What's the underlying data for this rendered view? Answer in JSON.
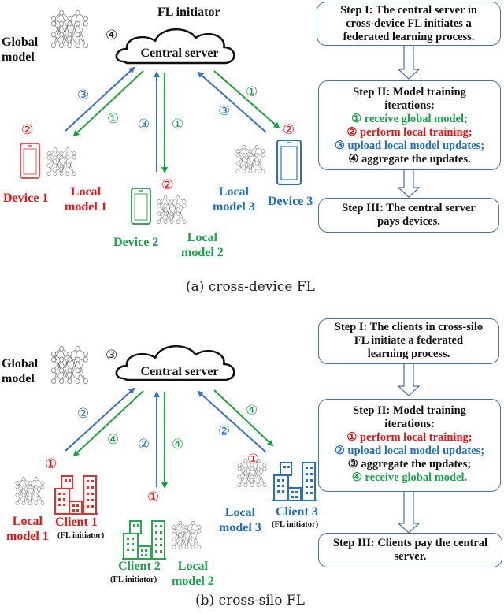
{
  "colors": {
    "red": "#ee1111",
    "green": "#1aa34a",
    "blue": "#1e6fc0",
    "arrow_blue": "#3b6fc8",
    "arrow_green": "#19a33a",
    "box_border": "#4a6fa5"
  },
  "panel_a": {
    "caption": "(a)  cross-device FL",
    "fl_initiator": "FL initiator",
    "server_label": "Central server",
    "global_model": [
      "Global",
      "model"
    ],
    "aggregate_marker": "④",
    "devices": [
      {
        "name": "Device 1",
        "local_model": [
          "Local",
          "model 1"
        ],
        "color": "red",
        "train_marker": "②",
        "up_marker": "③",
        "down_marker": "①"
      },
      {
        "name": "Device 2",
        "local_model": [
          "Local",
          "model 2"
        ],
        "color": "green",
        "train_marker": "②",
        "up_marker": "③",
        "down_marker": "①"
      },
      {
        "name": "Device 3",
        "local_model": [
          "Local",
          "model 3"
        ],
        "color": "blue",
        "train_marker": "②",
        "up_marker": "③",
        "down_marker": "①"
      }
    ],
    "steps": {
      "step1": [
        "Step I: The central server in",
        "cross-device FL initiates a",
        "federated learning process."
      ],
      "step2_title": [
        "Step II: Model training",
        "iterations:"
      ],
      "step2_items": [
        {
          "text": "① receive global model;",
          "color": "green"
        },
        {
          "text": "② perform local training;",
          "color": "red"
        },
        {
          "text": "③ upload local model updates;",
          "color": "blue"
        },
        {
          "text": "④ aggregate the updates.",
          "color": "black"
        }
      ],
      "step3": [
        "Step III: The central server",
        "pays devices."
      ]
    }
  },
  "panel_b": {
    "caption": "(b)  cross-silo FL",
    "server_label": "Central server",
    "global_model": [
      "Global",
      "model"
    ],
    "aggregate_marker": "③",
    "clients": [
      {
        "name": "Client 1",
        "sub": "(FL initiator)",
        "local_model": [
          "Local",
          "model 1"
        ],
        "color": "red",
        "train_marker": "①",
        "up_marker": "②",
        "down_marker": "④"
      },
      {
        "name": "Client 2",
        "sub": "(FL initiator)",
        "local_model": [
          "Local",
          "model 2"
        ],
        "color": "green",
        "train_marker": "①",
        "up_marker": "②",
        "down_marker": "④"
      },
      {
        "name": "Client 3",
        "sub": "(FL initiator)",
        "local_model": [
          "Local",
          "model 3"
        ],
        "color": "blue",
        "train_marker": "①",
        "up_marker": "②",
        "down_marker": "④"
      }
    ],
    "steps": {
      "step1": [
        "Step I: The clients in cross-silo",
        "FL initiate a federated",
        "learning process."
      ],
      "step2_title": [
        "Step II: Model training",
        "iterations:"
      ],
      "step2_items": [
        {
          "text": "① perform local training;",
          "color": "red"
        },
        {
          "text": "② upload local model updates;",
          "color": "blue"
        },
        {
          "text": "③ aggregate the updates;",
          "color": "black"
        },
        {
          "text": "④ receive global model.",
          "color": "green"
        }
      ],
      "step3": [
        "Step III: Clients pay the central",
        "server."
      ]
    }
  }
}
